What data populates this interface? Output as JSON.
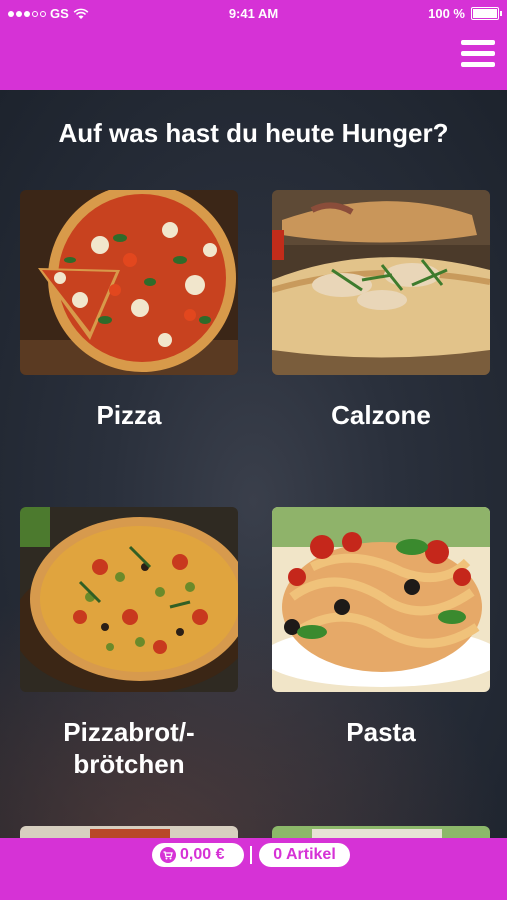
{
  "status_bar": {
    "carrier": "GS",
    "time": "9:41 AM",
    "battery": "100 %"
  },
  "headline": "Auf was hast du heute Hunger?",
  "categories": [
    {
      "label": "Pizza"
    },
    {
      "label": "Calzone"
    },
    {
      "label": "Pizzabrot/-\nbrötchen"
    },
    {
      "label": "Pasta"
    }
  ],
  "footer": {
    "price": "0,00 €",
    "items": "0 Artikel"
  },
  "colors": {
    "brand": "#d632d6",
    "text": "#ffffff"
  },
  "icons": {
    "menu": "hamburger-menu-icon",
    "cart": "cart-icon",
    "wifi": "wifi-icon",
    "battery": "battery-icon"
  }
}
